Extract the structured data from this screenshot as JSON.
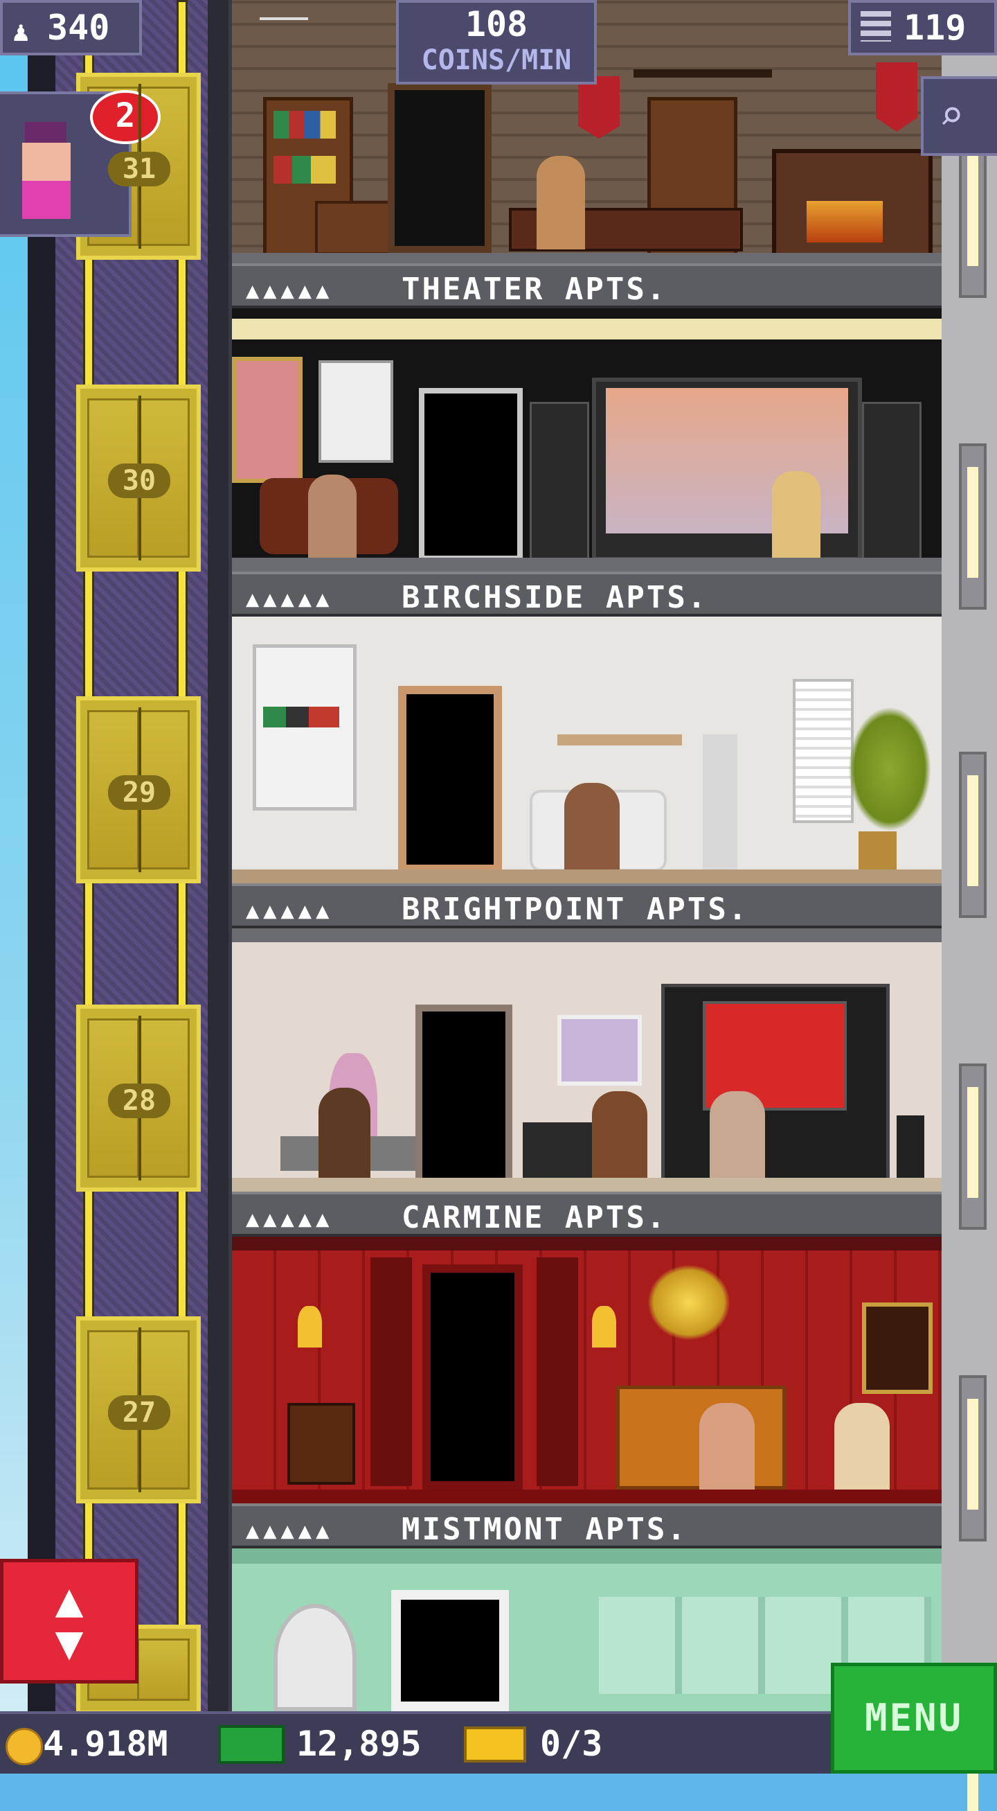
{
  "hud": {
    "population": "340",
    "coins_rate_value": "108",
    "coins_rate_unit": "COINS/MIN",
    "floors": "119"
  },
  "visitor": {
    "badge_count": "2"
  },
  "elevator": {
    "floor_numbers": [
      "31",
      "30",
      "29",
      "28",
      "27"
    ]
  },
  "floors": [
    {
      "name": "THEATER APTS.",
      "dots": "▲▲▲▲▲"
    },
    {
      "name": "BIRCHSIDE APTS.",
      "dots": "▲▲▲▲▲"
    },
    {
      "name": "BRIGHTPOINT APTS.",
      "dots": "▲▲▲▲▲"
    },
    {
      "name": "CARMINE APTS.",
      "dots": "▲▲▲▲▲"
    },
    {
      "name": "MISTMONT APTS.",
      "dots": "▲▲▲▲▲"
    }
  ],
  "bottom": {
    "coins": "4.918M",
    "bux": "12,895",
    "tickets": "0/3",
    "menu": "MENU"
  },
  "icons": {
    "population": "person-icon",
    "floors": "building-icon",
    "search": "magnifier-icon",
    "nav": "up-down-arrows-icon"
  },
  "colors": {
    "hud_bg": "#4b4a6c",
    "label_bar": "#5c5c63",
    "elevator_gold": "#c9b332",
    "menu_green": "#27b23a",
    "nav_red": "#e4283a"
  }
}
